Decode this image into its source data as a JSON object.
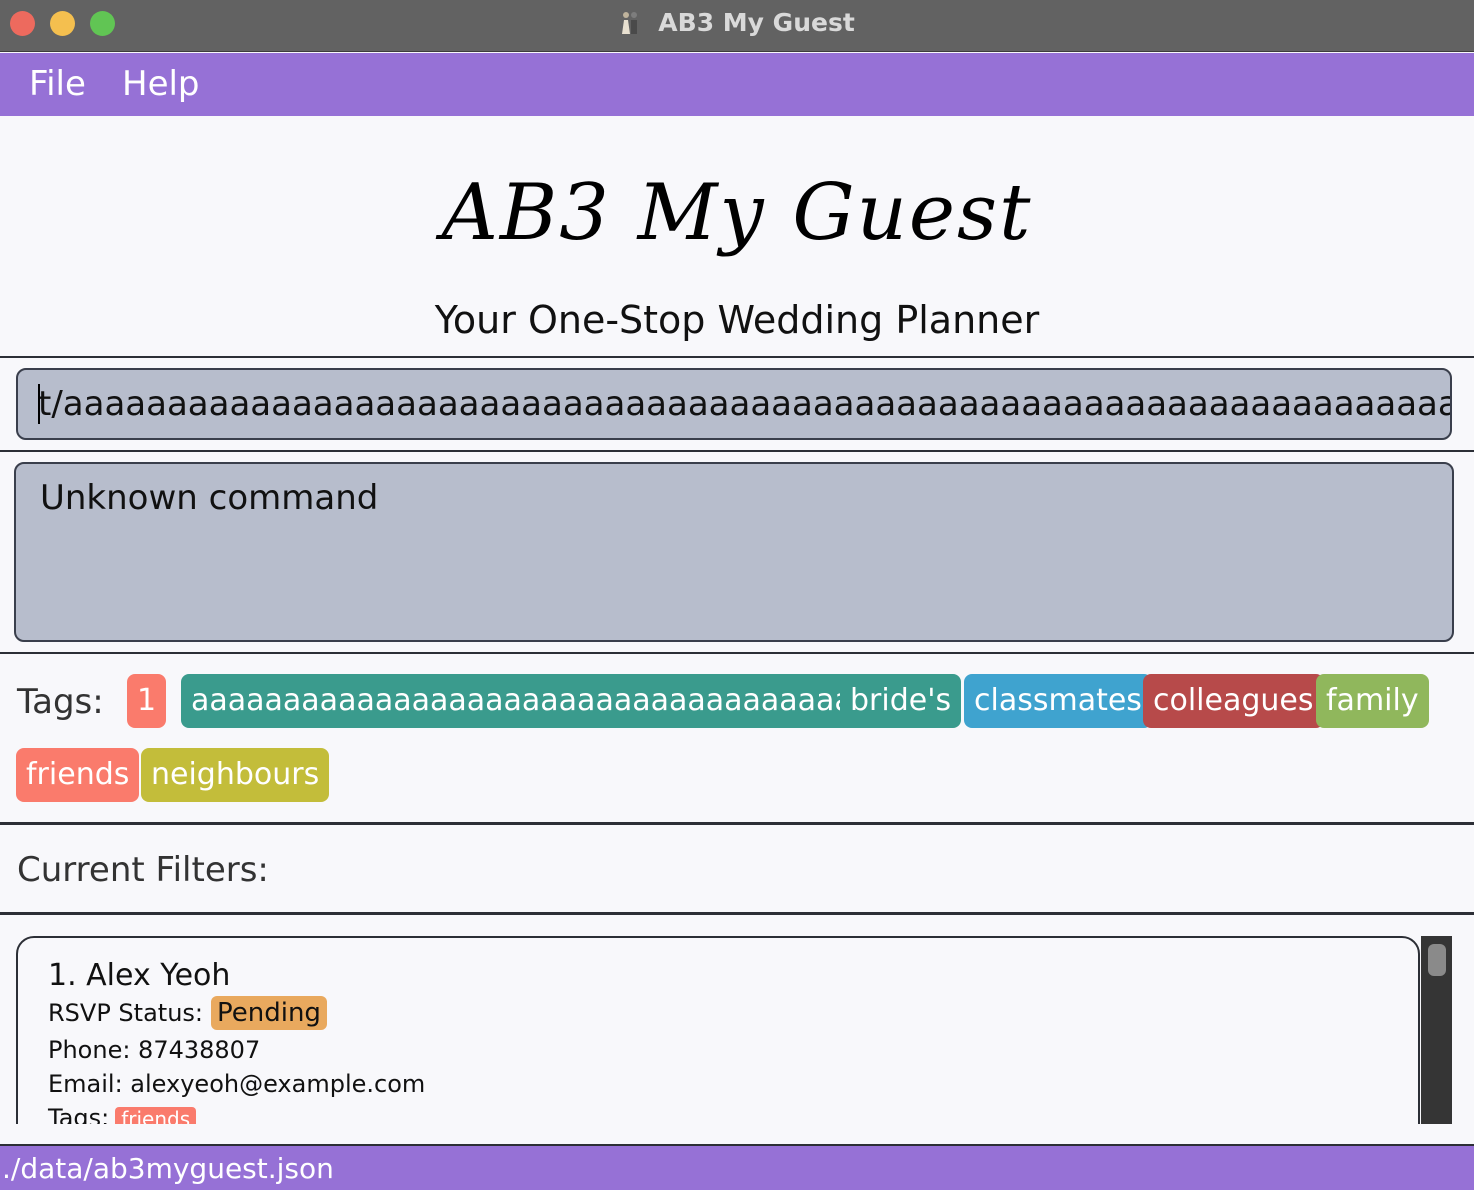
{
  "window": {
    "title": "AB3 My Guest"
  },
  "menubar": {
    "file": "File",
    "help": "Help"
  },
  "header": {
    "logo": "AB3 My Guest",
    "tagline": "Your One-Stop Wedding Planner"
  },
  "command": {
    "value": "t/aaaaaaaaaaaaaaaaaaaaaaaaaaaaaaaaaaaaaaaaaaaaaaaaaaaaaaaaaaaaaaaaaaaaaaaaaa"
  },
  "result": {
    "text": "Unknown command"
  },
  "tags": {
    "label": "Tags:",
    "items": [
      {
        "label": "1",
        "color": "#fa7b6c"
      },
      {
        "label": "aaaaaaaaaaaaaaaaaaaaaaaaaaaaaaaaaaaaaaa",
        "color": "#3a9b8d"
      },
      {
        "label": "bride's",
        "color": "#3a9b8d"
      },
      {
        "label": "classmates",
        "color": "#3fa3cf"
      },
      {
        "label": "colleagues",
        "color": "#b74a4a"
      },
      {
        "label": "family",
        "color": "#90b75c"
      },
      {
        "label": "friends",
        "color": "#fa7b6c"
      },
      {
        "label": "neighbours",
        "color": "#c3bd3a"
      }
    ]
  },
  "filters": {
    "label": "Current Filters:"
  },
  "guests": [
    {
      "name": "1. Alex Yeoh",
      "rsvp_label": "RSVP Status:",
      "rsvp": "Pending",
      "phone": "Phone: 87438807",
      "email": "Email: alexyeoh@example.com",
      "tags_label": "Tags:",
      "tag": "friends"
    }
  ],
  "status": {
    "path": "./data/ab3myguest.json"
  },
  "colors": {
    "accent": "#9671d6",
    "titlebar": "#626262",
    "box": "#b7bdcc",
    "pending": "#e9a95e"
  }
}
